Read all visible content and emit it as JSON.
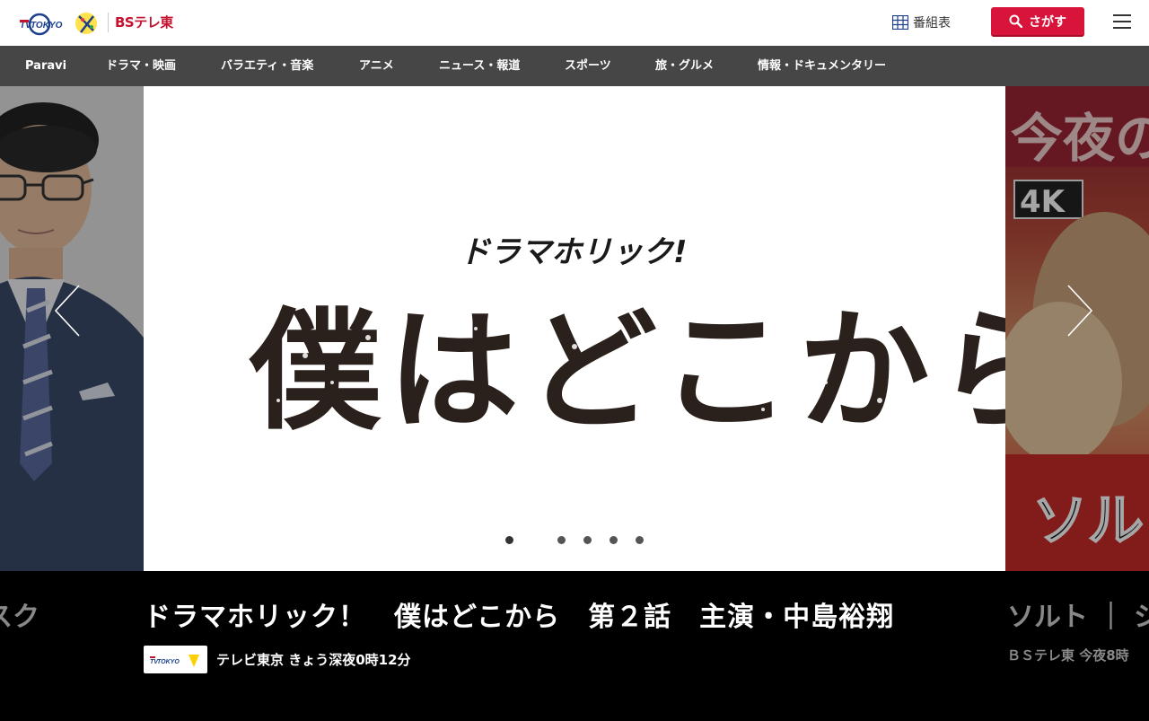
{
  "header": {
    "logo_text": "TV TOKYO",
    "bs_logo": "BSテレ東",
    "schedule_label": "番組表",
    "search_label": "さがす",
    "accent_color": "#d8143a"
  },
  "nav": {
    "items": [
      {
        "label": "Paravi"
      },
      {
        "label": "ドラマ・映画"
      },
      {
        "label": "バラエティ・音楽"
      },
      {
        "label": "アニメ"
      },
      {
        "label": "ニュース・報道"
      },
      {
        "label": "スポーツ"
      },
      {
        "label": "旅・グルメ"
      },
      {
        "label": "情報・ドキュメンタリー"
      }
    ]
  },
  "carousel": {
    "main_slide": {
      "series_label": "ドラマホリック!",
      "show_title": "僕はどこから"
    },
    "right_slide": {
      "overlay_text": "今夜の",
      "badge": "4K",
      "title_fragment": "ソルト"
    },
    "dots_count": 5,
    "active_dot": 0
  },
  "caption": {
    "main_title": "ドラマホリック！　僕はどこから　第２話　主演・中島裕翔",
    "main_channel_logo": "TV TOKYO",
    "main_channel_time": "テレビ東京 きょう深夜0時12分",
    "left_title": "スク",
    "right_title": "ソルト ｜ シネ",
    "right_sub": "ＢＳテレ東 今夜8時"
  }
}
